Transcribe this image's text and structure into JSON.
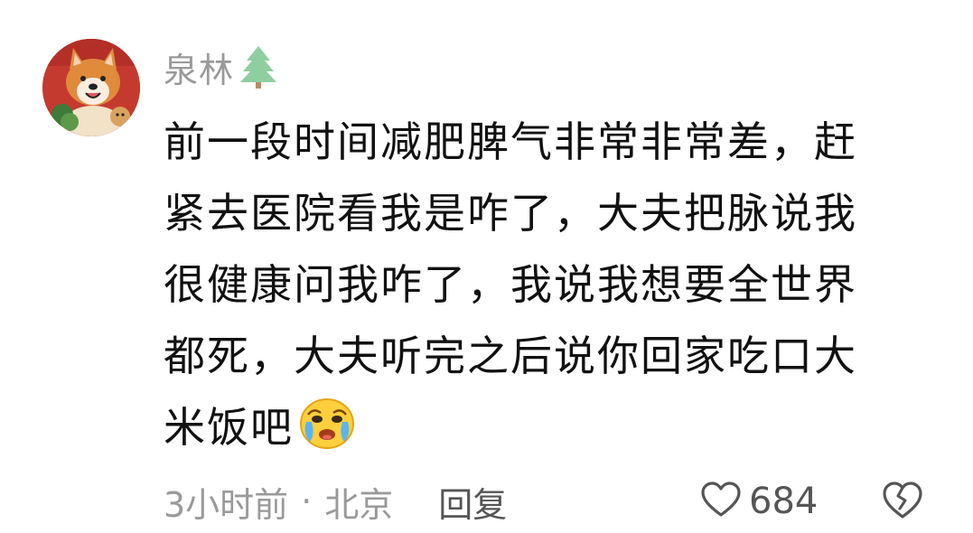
{
  "comment": {
    "username": "泉林",
    "username_badge_icon": "evergreen-tree-icon",
    "avatar_icon": "shiba-dog-avatar",
    "text_lines": [
      "前一段时间减肥脾气非常非常差，赶",
      "紧去医院看我是咋了，大夫把脉说我",
      "很健康问我咋了，我说我想要全世界",
      "都死，大夫听完之后说你回家吃口大",
      "米饭吧"
    ],
    "text_emoji_icon": "crying-face-emoji",
    "time": "3小时前",
    "separator": "·",
    "location": "北京",
    "reply_label": "回复",
    "like_icon": "heart-outline-icon",
    "like_count": "684",
    "dislike_icon": "broken-heart-icon",
    "colors": {
      "text": "#111111",
      "meta": "#9a9a9a",
      "action": "#555555"
    }
  }
}
